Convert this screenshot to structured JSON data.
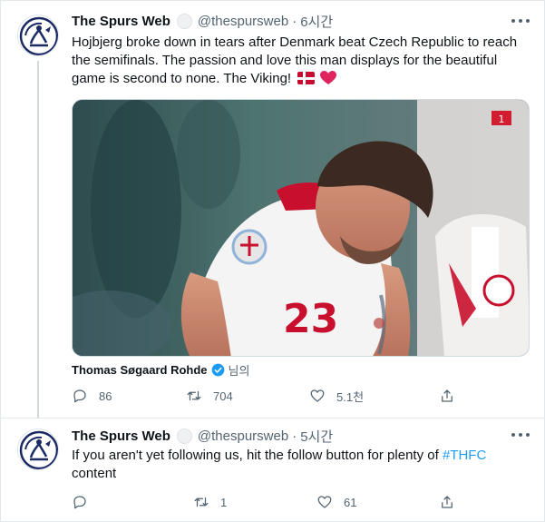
{
  "colors": {
    "text": "#0f1419",
    "secondary": "#536471",
    "link": "#1d9bf0",
    "border": "#e3e8ec",
    "heart": "#e0245e",
    "denmark_red": "#c60c30"
  },
  "tweets": [
    {
      "author_name": "The Spurs Web",
      "handle": "@thespursweb",
      "separator": "·",
      "time": "6시간",
      "text": "Hojbjerg broke down in tears after Denmark beat Czech Republic to reach the semifinals. The passion and love this man displays for the beautiful game is second to none. The Viking!",
      "emoji": [
        "flag-denmark-icon",
        "red-heart-icon"
      ],
      "media_caption_name": "Thomas Søgaard Rohde",
      "media_caption_suffix": "님의",
      "actions": {
        "replies": "86",
        "retweets": "704",
        "likes": "5.1천"
      }
    },
    {
      "author_name": "The Spurs Web",
      "handle": "@thespursweb",
      "separator": "·",
      "time": "5시간",
      "text_before": "If you aren't yet following us, hit the follow button for plenty of ",
      "hashtag": "#THFC",
      "text_after": " content",
      "actions": {
        "replies": "",
        "retweets": "1",
        "likes": "61"
      }
    }
  ]
}
